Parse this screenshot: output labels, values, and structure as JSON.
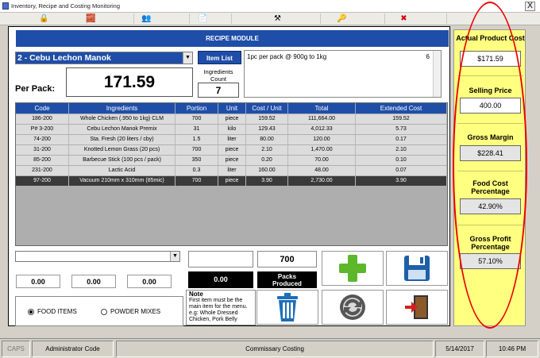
{
  "window": {
    "title": "Inventory, Recipe and Costing Monitoring",
    "close_glyph": "X"
  },
  "toolbar": {
    "items": [
      {
        "icon": "lock-icon",
        "glyph": "🔒"
      },
      {
        "icon": "boxes-icon",
        "glyph": "🧱"
      },
      {
        "icon": "users-icon",
        "glyph": "👥"
      },
      {
        "icon": "report-icon",
        "glyph": "📄"
      },
      {
        "icon": "tools-icon",
        "glyph": "⚒"
      },
      {
        "icon": "key-icon",
        "glyph": "🔑"
      },
      {
        "icon": "close-icon",
        "glyph": "✖"
      }
    ]
  },
  "module": {
    "title": "RECIPE MODULE"
  },
  "recipe": {
    "selected": "2 - Cebu Lechon Manok",
    "item_list_label": "Item List"
  },
  "per_pack": {
    "label": "Per Pack:",
    "value": "171.59"
  },
  "ingredients_count": {
    "label": "Ingredients Count",
    "value": "7"
  },
  "description": {
    "text": "1pc per pack @ 900g to 1kg",
    "number": "6"
  },
  "table": {
    "headers": [
      "Code",
      "Ingredients",
      "Portion",
      "Unit",
      "Cost / Unit",
      "Total",
      "Extended Cost"
    ],
    "rows": [
      [
        "186-200",
        "Whole Chicken (.950 to 1kg) CLM",
        "700",
        "piece",
        "159.52",
        "111,664.00",
        "159.52"
      ],
      [
        "P# 3-200",
        "Cebu Lechon Manok Premix",
        "31",
        "kilo",
        "129.43",
        "4,012.33",
        "5.73"
      ],
      [
        "74-200",
        "Sta. Fresh (20 liters / cby)",
        "1.5",
        "liter",
        "80.00",
        "120.00",
        "0.17"
      ],
      [
        "31-200",
        "Knotted Lemon Grass (20 pcs)",
        "700",
        "piece",
        "2.10",
        "1,470.00",
        "2.10"
      ],
      [
        "85-200",
        "Barbecue Stick (100 pcs / pack)",
        "350",
        "piece",
        "0.20",
        "70.00",
        "0.10"
      ],
      [
        "231-200",
        "Lactic Acid",
        "0.3",
        "liter",
        "160.00",
        "48.00",
        "0.07"
      ],
      [
        "97-200",
        "Vacuum 210mm x 310mm (85mic)",
        "700",
        "piece",
        "3.90",
        "2,730.00",
        "3.90"
      ]
    ],
    "selected_row": 6
  },
  "bottom": {
    "select_value": "",
    "small_values": [
      "0.00",
      "0.00",
      "0.00"
    ],
    "total_value": "0.00",
    "packs_value": "700",
    "packs_label_1": "Packs",
    "packs_label_2": "Produced"
  },
  "item_type": {
    "options": [
      "FOOD ITEMS",
      "POWDER MIXES"
    ],
    "selected": "FOOD ITEMS"
  },
  "note": {
    "title": "Note",
    "text": "First item must be the main item for the menu. e.g: Whole Dressed Chicken, Pork Belly"
  },
  "sidebar": {
    "actual_cost": {
      "label": "Actual Product Cost",
      "value": "$171.59"
    },
    "selling_price": {
      "label": "Selling Price",
      "value": "400.00"
    },
    "gross_margin": {
      "label": "Gross Margin",
      "value": "$228.41"
    },
    "food_cost_pct": {
      "label": "Food Cost Percentage",
      "value": "42.90%"
    },
    "gross_profit_pct": {
      "label": "Gross Profit Percentage",
      "value": "57.10%"
    }
  },
  "status": {
    "caps": "CAPS",
    "user": "Administrator Code",
    "department": "Commissary Costing",
    "date": "5/14/2017",
    "time": "10:46 PM"
  },
  "colors": {
    "header_blue": "#1f4ea8",
    "panel_yellow": "#ffff80",
    "annotation_red": "#e00000"
  }
}
